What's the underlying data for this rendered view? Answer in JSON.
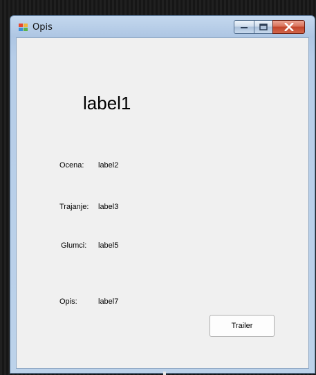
{
  "window": {
    "title": "Opis"
  },
  "form": {
    "title_label": "label1",
    "ocena_caption": "Ocena:",
    "ocena_value": "label2",
    "trajanje_caption": "Trajanje:",
    "trajanje_value": "label3",
    "glumci_caption": "Glumci:",
    "glumci_value": "label5",
    "opis_caption": "Opis:",
    "opis_value": "label7",
    "trailer_button": "Trailer"
  },
  "icons": {
    "app": "windows-form-icon",
    "minimize": "minimize-icon",
    "maximize": "maximize-icon",
    "close": "close-icon"
  },
  "colors": {
    "titlebar": "#b6cde8",
    "client_background": "#f0f0f0",
    "close_button": "#c2442a"
  }
}
